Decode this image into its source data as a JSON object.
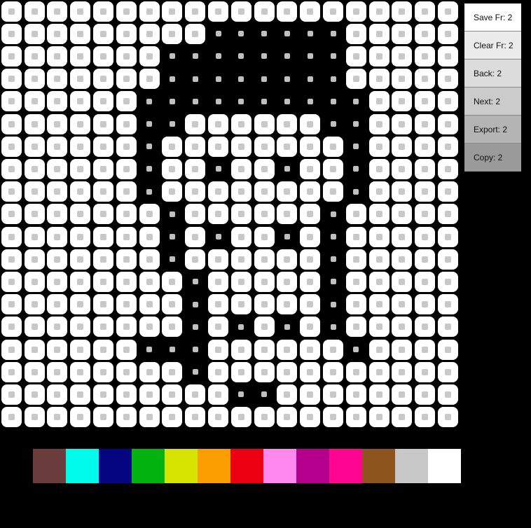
{
  "grid": {
    "cols": 20,
    "rows": 19,
    "on_color": "#ffffff",
    "dot_color": "#c0c0c0",
    "mask": [
      "11111111111111111111",
      "11111111100000011111",
      "11111110000000011111",
      "11111110000000011111",
      "11111100000000001111",
      "11111100111111001111",
      "11111101111111101111",
      "11111101101101101111",
      "11111101111111101111",
      "11111110111111011111",
      "11111110101101011111",
      "11111110111111011111",
      "11111111011111011111",
      "11111111011111011111",
      "11111111010101011111",
      "11111100011111101111",
      "11111111011111111111",
      "11111111110011111111",
      "11111111111111111111"
    ]
  },
  "menu": {
    "buttons": [
      {
        "label": "Save Fr: 2",
        "bg": "#ffffff"
      },
      {
        "label": "Clear Fr: 2",
        "bg": "#ebebeb"
      },
      {
        "label": "Back: 2",
        "bg": "#dcdcdc"
      },
      {
        "label": "Next: 2",
        "bg": "#cbcbcb"
      },
      {
        "label": "Export: 2",
        "bg": "#b4b4b4"
      },
      {
        "label": "Copy: 2",
        "bg": "#9a9a9a"
      }
    ]
  },
  "palette": {
    "colors": [
      "#6b3d3d",
      "#00fbeb",
      "#050582",
      "#03b40f",
      "#d7e300",
      "#fd9e00",
      "#ec0012",
      "#ff88ef",
      "#b4008c",
      "#ff0592",
      "#8d551d",
      "#c8c8c8",
      "#ffffff"
    ]
  }
}
